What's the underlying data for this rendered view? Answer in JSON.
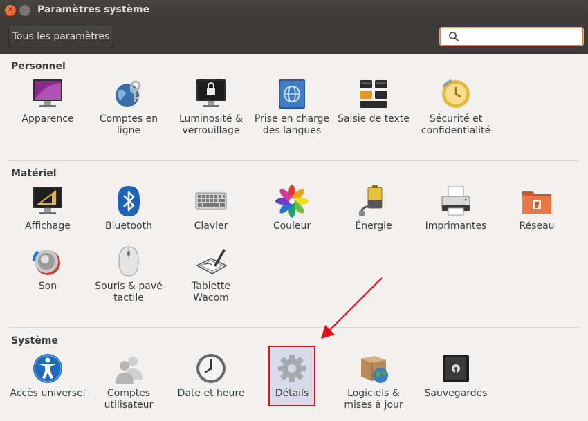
{
  "window": {
    "title": "Paramètres système"
  },
  "toolbar": {
    "all_settings_label": "Tous les paramètres",
    "search_value": ""
  },
  "sections": {
    "personnel": {
      "title": "Personnel",
      "items": [
        {
          "label": "Apparence",
          "icon": "appearance-icon"
        },
        {
          "label": "Comptes en ligne",
          "icon": "online-accounts-icon"
        },
        {
          "label": "Luminosité & verrouillage",
          "icon": "brightness-lock-icon"
        },
        {
          "label": "Prise en charge des langues",
          "icon": "language-support-icon"
        },
        {
          "label": "Saisie de texte",
          "icon": "text-entry-icon"
        },
        {
          "label": "Sécurité et confidentialité",
          "icon": "security-privacy-icon"
        }
      ]
    },
    "materiel": {
      "title": "Matériel",
      "items": [
        {
          "label": "Affichage",
          "icon": "display-icon"
        },
        {
          "label": "Bluetooth",
          "icon": "bluetooth-icon"
        },
        {
          "label": "Clavier",
          "icon": "keyboard-icon"
        },
        {
          "label": "Couleur",
          "icon": "color-icon"
        },
        {
          "label": "Énergie",
          "icon": "power-icon"
        },
        {
          "label": "Imprimantes",
          "icon": "printer-icon"
        },
        {
          "label": "Réseau",
          "icon": "network-icon"
        },
        {
          "label": "Son",
          "icon": "sound-icon"
        },
        {
          "label": "Souris & pavé tactile",
          "icon": "mouse-icon"
        },
        {
          "label": "Tablette Wacom",
          "icon": "wacom-icon"
        }
      ]
    },
    "systeme": {
      "title": "Système",
      "items": [
        {
          "label": "Accès universel",
          "icon": "universal-access-icon"
        },
        {
          "label": "Comptes utilisateur",
          "icon": "user-accounts-icon"
        },
        {
          "label": "Date et heure",
          "icon": "clock-icon"
        },
        {
          "label": "Détails",
          "icon": "gear-icon"
        },
        {
          "label": "Logiciels & mises à jour",
          "icon": "software-updates-icon"
        },
        {
          "label": "Sauvegardes",
          "icon": "backup-safe-icon"
        }
      ]
    }
  },
  "annotation": {
    "highlight_color": "#e0111b",
    "target": "Détails"
  }
}
